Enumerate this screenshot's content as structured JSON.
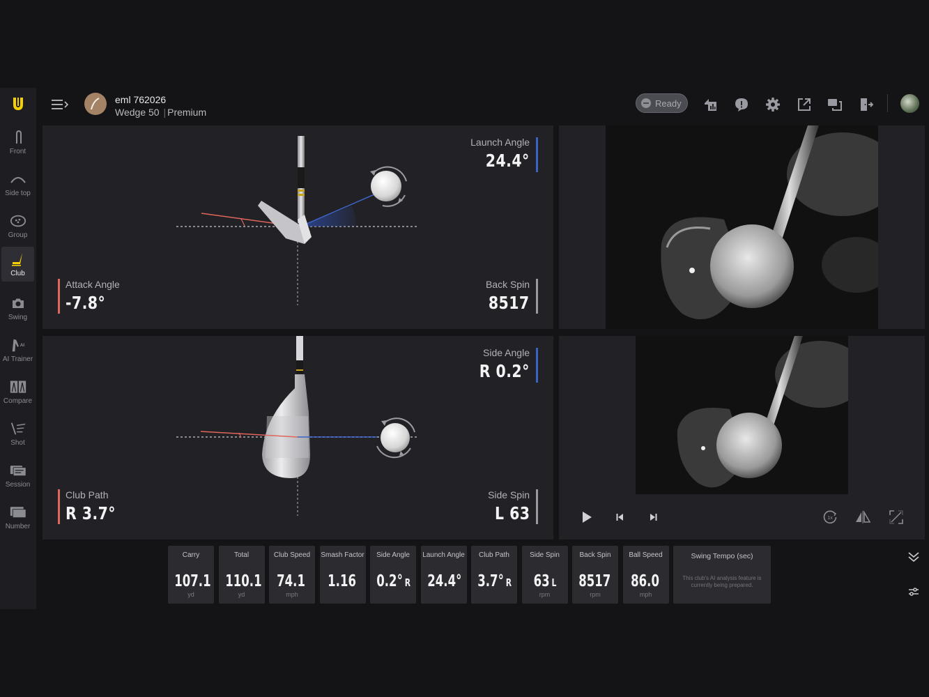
{
  "sidebar": {
    "items": [
      {
        "label": "Front",
        "icon": "front-view-icon"
      },
      {
        "label": "Side top",
        "icon": "side-top-view-icon"
      },
      {
        "label": "Group",
        "icon": "group-icon"
      },
      {
        "label": "Club",
        "icon": "club-icon",
        "active": true
      },
      {
        "label": "Swing",
        "icon": "camera-icon"
      },
      {
        "label": "AI Trainer",
        "icon": "ai-trainer-icon"
      },
      {
        "label": "Compare",
        "icon": "compare-icon"
      },
      {
        "label": "Shot",
        "icon": "shot-icon"
      },
      {
        "label": "Session",
        "icon": "session-icon"
      },
      {
        "label": "Number",
        "icon": "number-icon"
      }
    ]
  },
  "header": {
    "user_name": "eml 762026",
    "club": "Wedge 50",
    "separator": "|",
    "tier": "Premium",
    "status_label": "Ready"
  },
  "impact_side": {
    "launch_angle_label": "Launch Angle",
    "launch_angle_value": "24.4°",
    "attack_angle_label": "Attack Angle",
    "attack_angle_value": "-7.8°",
    "back_spin_label": "Back Spin",
    "back_spin_value": "8517"
  },
  "impact_top": {
    "side_angle_label": "Side Angle",
    "side_angle_value": "R 0.2°",
    "club_path_label": "Club Path",
    "club_path_value": "R 3.7°",
    "side_spin_label": "Side Spin",
    "side_spin_value": "L 63"
  },
  "metrics": [
    {
      "label": "Carry",
      "value": "107.1",
      "suffix": "",
      "unit": "yd"
    },
    {
      "label": "Total",
      "value": "110.1",
      "suffix": "",
      "unit": "yd"
    },
    {
      "label": "Club Speed",
      "value": "74.1",
      "suffix": "",
      "unit": "mph"
    },
    {
      "label": "Smash Factor",
      "value": "1.16",
      "suffix": "",
      "unit": ""
    },
    {
      "label": "Side Angle",
      "value": "0.2°",
      "suffix": "R",
      "unit": ""
    },
    {
      "label": "Launch Angle",
      "value": "24.4°",
      "suffix": "",
      "unit": ""
    },
    {
      "label": "Club Path",
      "value": "3.7°",
      "suffix": "R",
      "unit": ""
    },
    {
      "label": "Side Spin",
      "value": "63",
      "suffix": "L",
      "unit": "rpm"
    },
    {
      "label": "Back Spin",
      "value": "8517",
      "suffix": "",
      "unit": "rpm"
    },
    {
      "label": "Ball Speed",
      "value": "86.0",
      "suffix": "",
      "unit": "mph"
    }
  ],
  "swing_tempo": {
    "label": "Swing Tempo (sec)",
    "note_line1": "This club's AI analysis feature is",
    "note_line2": "currently being prepared."
  },
  "playback": {
    "speed_label": "1x"
  },
  "colors": {
    "accent": "#f5d000",
    "attack_red": "#e0655a",
    "launch_blue": "#3c63c4",
    "panel_bg": "#222226"
  }
}
